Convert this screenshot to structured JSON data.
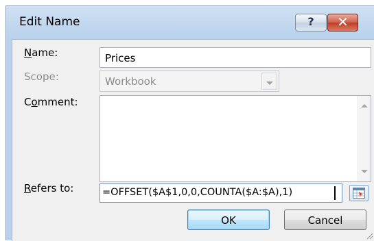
{
  "window": {
    "title": "Edit Name",
    "help_glyph": "?",
    "close_glyph": "✕"
  },
  "form": {
    "name": {
      "label_prefix": "",
      "label_mnemonic": "N",
      "label_rest": "ame:",
      "value": "Prices"
    },
    "scope": {
      "label": "Scope:",
      "value": "Workbook"
    },
    "comment": {
      "label_prefix": "C",
      "label_mnemonic": "o",
      "label_rest": "mment:",
      "value": ""
    },
    "refers_to": {
      "label_prefix": "",
      "label_mnemonic": "R",
      "label_rest": "efers to:",
      "value": "=OFFSET($A$1,0,0,COUNTA($A:$A),1)"
    }
  },
  "buttons": {
    "ok": "OK",
    "cancel": "Cancel"
  }
}
